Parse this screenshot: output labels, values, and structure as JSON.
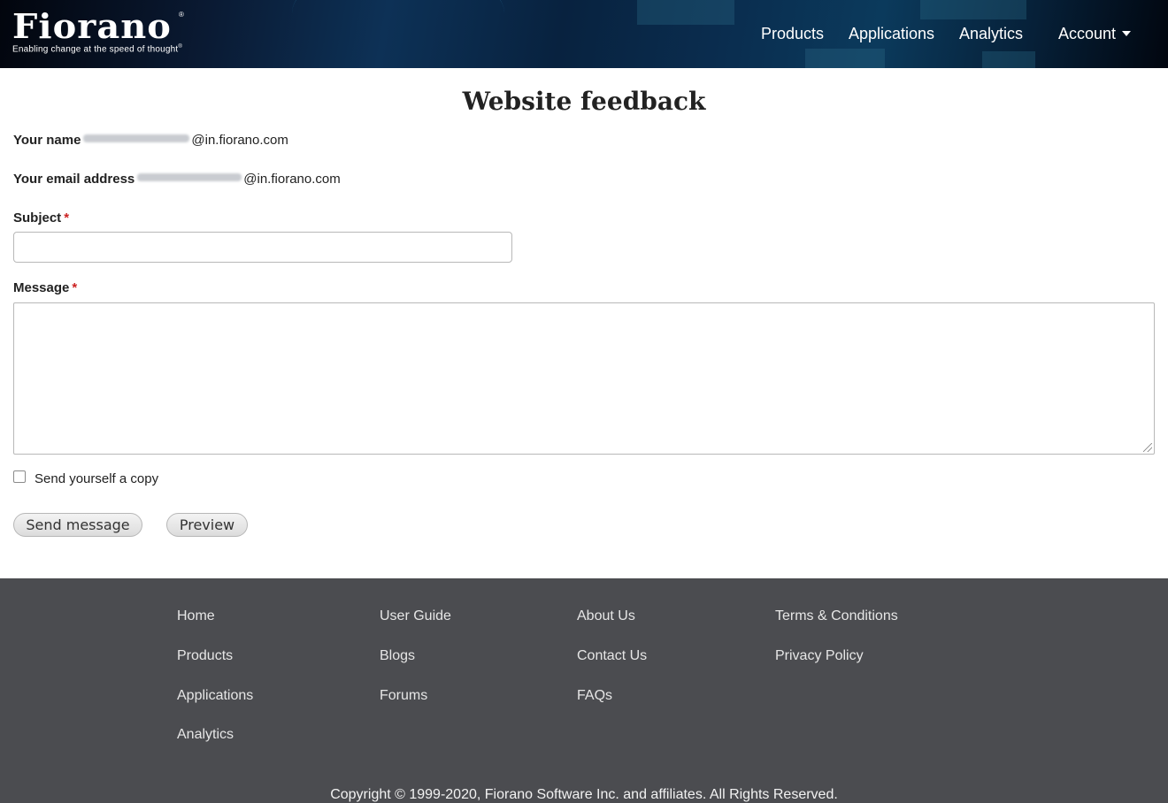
{
  "brand": {
    "name": "Fiorano",
    "tagline": "Enabling change at the speed of thought"
  },
  "nav": {
    "products": "Products",
    "applications": "Applications",
    "analytics": "Analytics",
    "account": "Account"
  },
  "page": {
    "title": "Website feedback"
  },
  "form": {
    "name_label": "Your name",
    "name_value_suffix": "@in.fiorano.com",
    "email_label": "Your email address",
    "email_value_suffix": "@in.fiorano.com",
    "subject_label": "Subject",
    "subject_value": "",
    "message_label": "Message",
    "message_value": "",
    "required_marker": "*",
    "copy_label": "Send yourself a copy",
    "copy_checked": false,
    "send_button": "Send message",
    "preview_button": "Preview"
  },
  "footer": {
    "col1": [
      "Home",
      "Products",
      "Applications",
      "Analytics"
    ],
    "col2": [
      "User Guide",
      "Blogs",
      "Forums"
    ],
    "col3": [
      "About Us",
      "Contact Us",
      "FAQs"
    ],
    "col4": [
      "Terms & Conditions",
      "Privacy Policy"
    ],
    "copyright": "Copyright © 1999-2020, Fiorano Software Inc. and affiliates. All Rights Reserved."
  }
}
